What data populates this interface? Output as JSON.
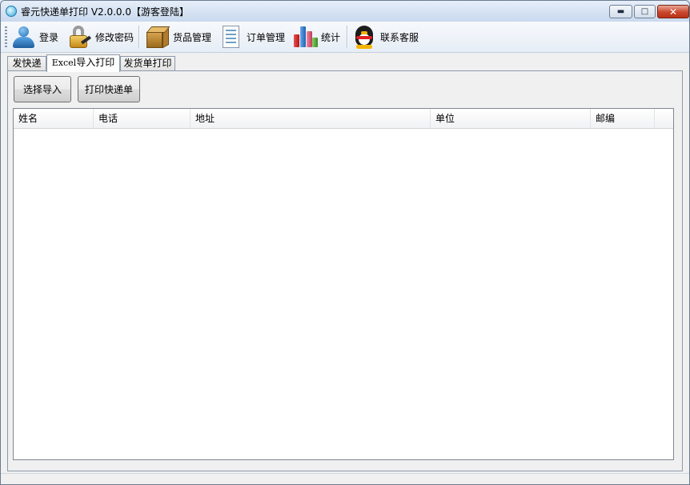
{
  "window": {
    "title": "睿元快递单打印 V2.0.0.0【游客登陆】",
    "controls": {
      "minimize": "▬",
      "maximize": "□",
      "close": "✕"
    }
  },
  "toolbar": {
    "items": [
      {
        "label": "登录",
        "icon": "user-icon"
      },
      {
        "label": "修改密码",
        "icon": "lock-key-icon"
      },
      {
        "label": "货品管理",
        "icon": "package-box-icon"
      },
      {
        "label": "订单管理",
        "icon": "document-list-icon"
      },
      {
        "label": "统计",
        "icon": "bar-chart-icon"
      },
      {
        "label": "联系客服",
        "icon": "qq-penguin-icon"
      }
    ]
  },
  "tabs": [
    {
      "label": "发快递"
    },
    {
      "label_latin": "Excel",
      "label": "导入打印",
      "active": true
    },
    {
      "label": "发货单打印"
    }
  ],
  "actions": {
    "import_label": "选择导入",
    "print_label": "打印快递单"
  },
  "table": {
    "columns": [
      "姓名",
      "电话",
      "地址",
      "单位",
      "邮编"
    ],
    "rows": []
  }
}
